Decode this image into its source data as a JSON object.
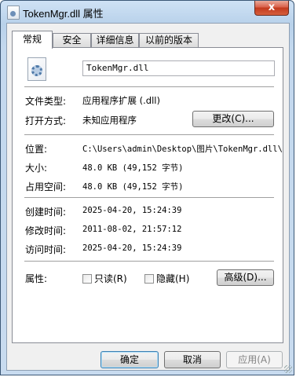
{
  "window": {
    "title": "TokenMgr.dll 属性",
    "close_glyph": "x"
  },
  "tabs": [
    {
      "label": "常规",
      "active": true
    },
    {
      "label": "安全",
      "active": false
    },
    {
      "label": "详细信息",
      "active": false
    },
    {
      "label": "以前的版本",
      "active": false
    }
  ],
  "general": {
    "icon": "dll-file-icon",
    "file_name": "TokenMgr.dll",
    "type_label": "文件类型:",
    "type_value": "应用程序扩展 (.dll)",
    "open_with_label": "打开方式:",
    "open_with_value": "未知应用程序",
    "change_button": "更改(C)...",
    "location_label": "位置:",
    "location_value": "C:\\Users\\admin\\Desktop\\图片\\TokenMgr.dll\\",
    "size_label": "大小:",
    "size_value": "48.0 KB (49,152 字节)",
    "size_on_disk_label": "占用空间:",
    "size_on_disk_value": "48.0 KB (49,152 字节)",
    "created_label": "创建时间:",
    "created_value": "2025-04-20, 15:24:39",
    "modified_label": "修改时间:",
    "modified_value": "2011-08-02, 21:57:12",
    "accessed_label": "访问时间:",
    "accessed_value": "2025-04-20, 15:24:39",
    "attributes_label": "属性:",
    "readonly_label": "只读(R)",
    "readonly_checked": false,
    "hidden_label": "隐藏(H)",
    "hidden_checked": false,
    "advanced_button": "高级(D)..."
  },
  "footer": {
    "ok_button": "确定",
    "cancel_button": "取消",
    "apply_button": "应用(A)"
  }
}
